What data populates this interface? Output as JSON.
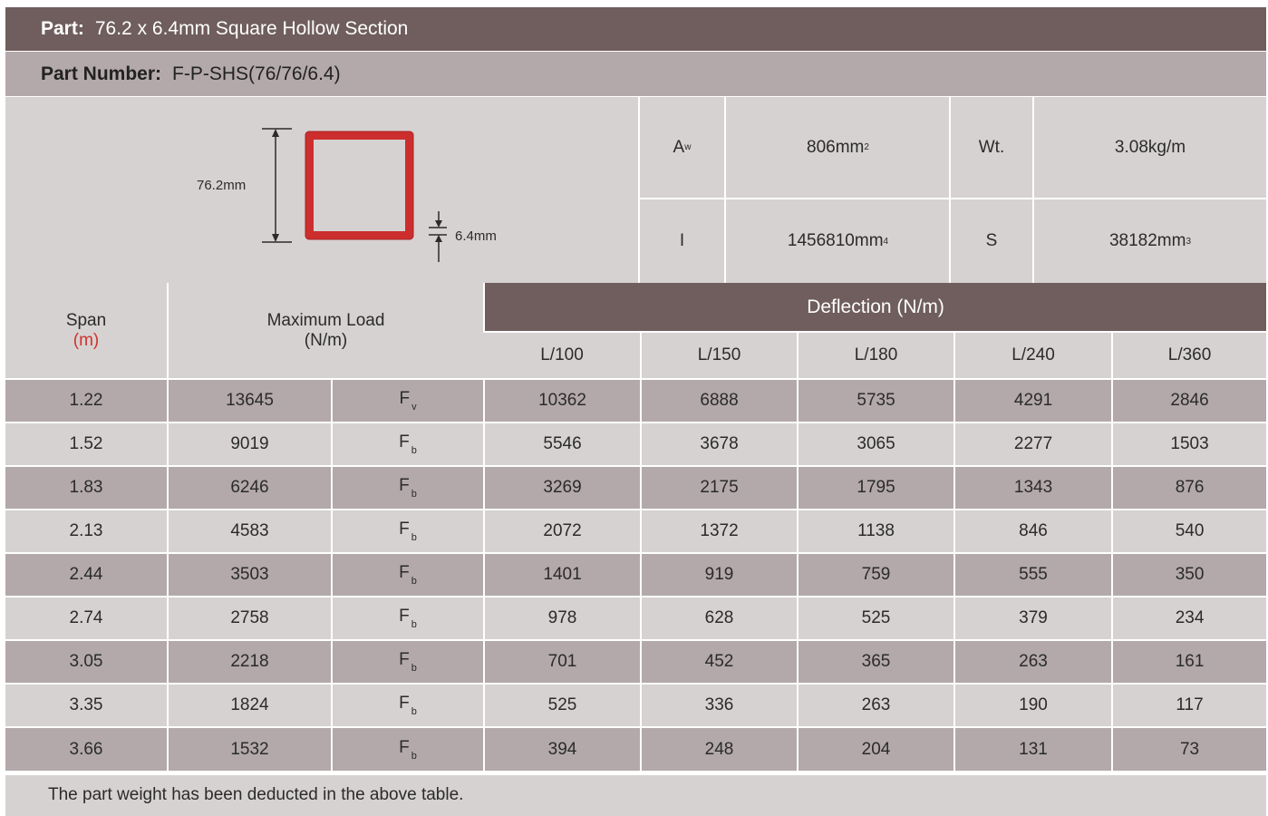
{
  "header": {
    "part_label": "Part:",
    "part_value": "76.2 x 6.4mm Square Hollow Section",
    "part_number_label": "Part Number:",
    "part_number_value": "F-P-SHS(76/76/6.4)"
  },
  "diagram": {
    "height_label": "76.2mm",
    "thickness_label": "6.4mm",
    "section_color": "#d0312d"
  },
  "properties": {
    "aw_symbol": "A",
    "aw_subscript": "w",
    "aw_value": "806mm",
    "aw_unit_sup": "2",
    "wt_label": "Wt.",
    "wt_value": "3.08kg/m",
    "i_label": "I",
    "i_value": "1456810mm",
    "i_unit_sup": "4",
    "s_label": "S",
    "s_value": "38182mm",
    "s_unit_sup": "3"
  },
  "table": {
    "span_header": "Span",
    "span_unit": "(m)",
    "max_load_header": "Maximum Load",
    "max_load_unit": "(N/m)",
    "deflection_header": "Deflection (N/m)",
    "deflection_columns": [
      "L/100",
      "L/150",
      "L/180",
      "L/240",
      "L/360"
    ],
    "rows": [
      {
        "span": "1.22",
        "max_load": "13645",
        "mode": "F",
        "mode_sub": "v",
        "deflections": [
          "10362",
          "6888",
          "5735",
          "4291",
          "2846"
        ]
      },
      {
        "span": "1.52",
        "max_load": "9019",
        "mode": "F",
        "mode_sub": "b",
        "deflections": [
          "5546",
          "3678",
          "3065",
          "2277",
          "1503"
        ]
      },
      {
        "span": "1.83",
        "max_load": "6246",
        "mode": "F",
        "mode_sub": "b",
        "deflections": [
          "3269",
          "2175",
          "1795",
          "1343",
          "876"
        ]
      },
      {
        "span": "2.13",
        "max_load": "4583",
        "mode": "F",
        "mode_sub": "b",
        "deflections": [
          "2072",
          "1372",
          "1138",
          "846",
          "540"
        ]
      },
      {
        "span": "2.44",
        "max_load": "3503",
        "mode": "F",
        "mode_sub": "b",
        "deflections": [
          "1401",
          "919",
          "759",
          "555",
          "350"
        ]
      },
      {
        "span": "2.74",
        "max_load": "2758",
        "mode": "F",
        "mode_sub": "b",
        "deflections": [
          "978",
          "628",
          "525",
          "379",
          "234"
        ]
      },
      {
        "span": "3.05",
        "max_load": "2218",
        "mode": "F",
        "mode_sub": "b",
        "deflections": [
          "701",
          "452",
          "365",
          "263",
          "161"
        ]
      },
      {
        "span": "3.35",
        "max_load": "1824",
        "mode": "F",
        "mode_sub": "b",
        "deflections": [
          "525",
          "336",
          "263",
          "190",
          "117"
        ]
      },
      {
        "span": "3.66",
        "max_load": "1532",
        "mode": "F",
        "mode_sub": "b",
        "deflections": [
          "394",
          "248",
          "204",
          "131",
          "73"
        ]
      }
    ]
  },
  "footer": {
    "note": "The part weight has been deducted in the above table."
  },
  "colors": {
    "dark_band": "#6f5e5d",
    "mid_band": "#b3a9aa",
    "light_band": "#d6d2d1",
    "accent_red": "#d0312d"
  }
}
